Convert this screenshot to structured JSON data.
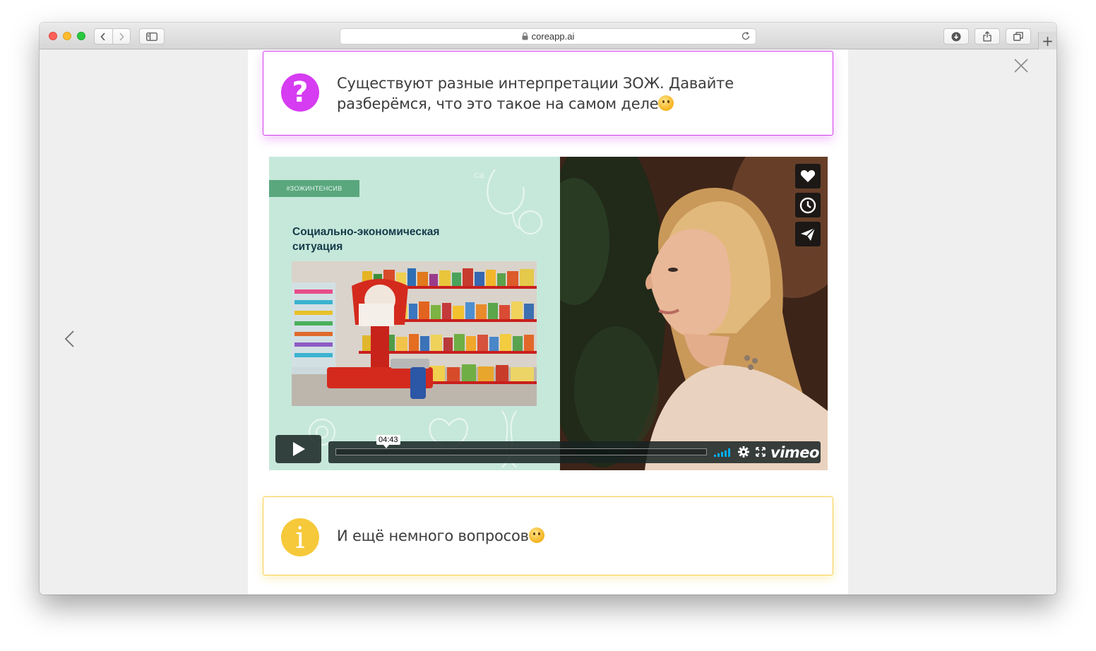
{
  "browser": {
    "url": "coreapp.ai"
  },
  "cards": {
    "question": {
      "badge_glyph": "?",
      "text": "Существуют разные интерпретации ЗОЖ. Давайте разберёмся, что это такое на самом деле",
      "emoji": "thinking-face",
      "accent": "#d63cf1"
    },
    "info": {
      "badge_glyph": "i",
      "text": "И ещё немного вопросов",
      "emoji": "winking-face",
      "accent": "#f6c93a"
    }
  },
  "video": {
    "slide_tag": "#ЗОЖИНТЕНСИВ",
    "slide_heading": "Социально-экономическая ситуация",
    "timecode": "04:43",
    "brand": "vimeo",
    "progress": 0,
    "volume_color": "#00adef"
  },
  "icons": {
    "close": "close-icon",
    "prev": "chevron-left-icon",
    "like": "heart-icon",
    "watch_later": "clock-icon",
    "share": "paper-plane-icon"
  }
}
